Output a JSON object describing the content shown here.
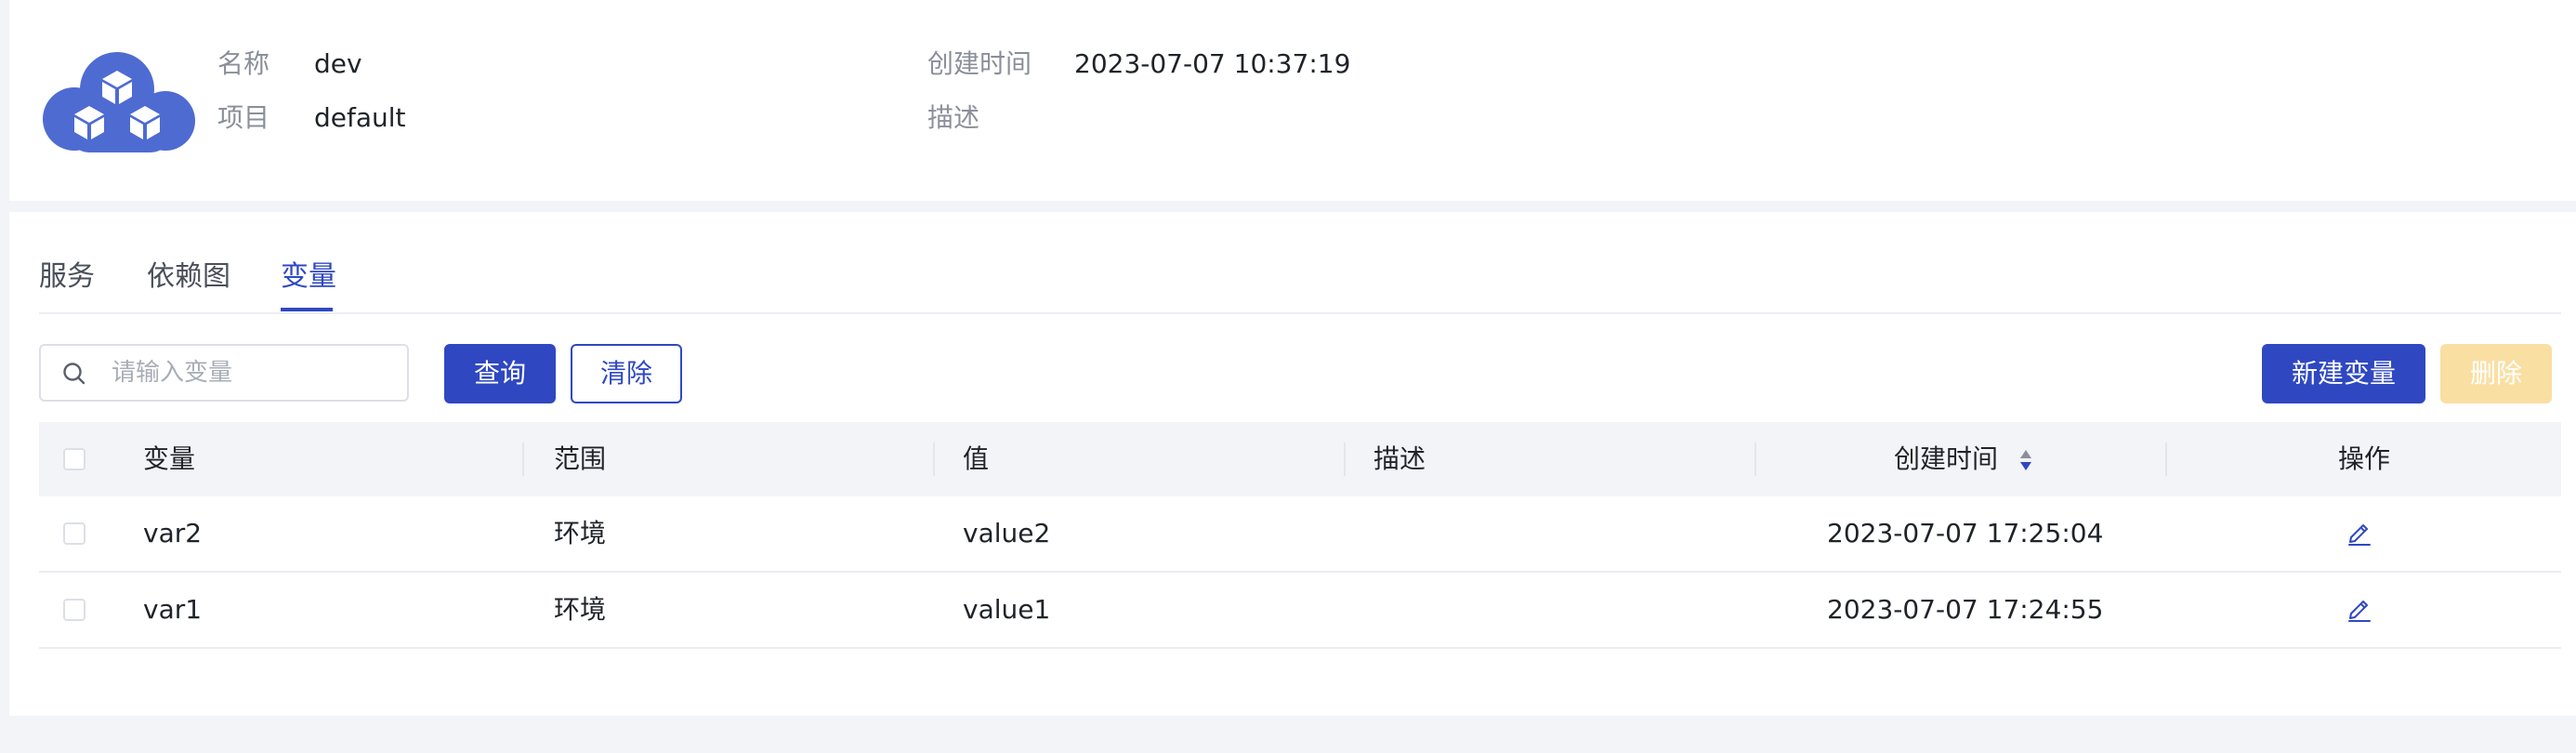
{
  "header": {
    "logo_icon": "cloud-cubes-logo",
    "name_label": "名称",
    "name_value": "dev",
    "project_label": "项目",
    "project_value": "default",
    "created_label": "创建时间",
    "created_value": "2023-07-07 10:37:19",
    "description_label": "描述",
    "description_value": ""
  },
  "tabs": [
    {
      "label": "服务",
      "active": false
    },
    {
      "label": "依赖图",
      "active": false
    },
    {
      "label": "变量",
      "active": true
    }
  ],
  "toolbar": {
    "search_placeholder": "请输入变量",
    "search_value": "",
    "search_icon": "search-icon",
    "query_label": "查询",
    "clear_label": "清除",
    "new_variable_label": "新建变量",
    "delete_label": "删除"
  },
  "table": {
    "columns": [
      "变量",
      "范围",
      "值",
      "描述",
      "创建时间",
      "操作"
    ],
    "sort_icon": "sort-icon",
    "rows": [
      {
        "variable": "var2",
        "scope": "环境",
        "value": "value2",
        "description": "",
        "created": "2023-07-07 17:25:04",
        "action_icon": "edit-icon"
      },
      {
        "variable": "var1",
        "scope": "环境",
        "value": "value1",
        "description": "",
        "created": "2023-07-07 17:24:55",
        "action_icon": "edit-icon"
      }
    ]
  },
  "colors": {
    "primary": "#2f48c1",
    "disabled_button": "#fadfa3",
    "logo": "#4e6bd2",
    "background": "#f3f4f7"
  }
}
